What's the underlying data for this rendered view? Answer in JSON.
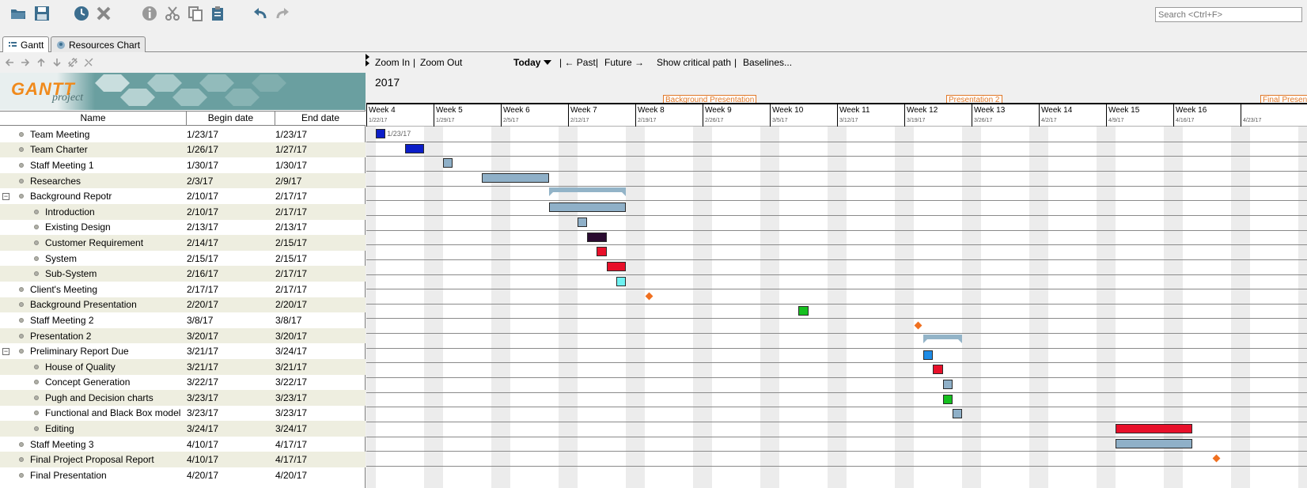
{
  "toolbar": {
    "search_placeholder": "Search <Ctrl+F>"
  },
  "tabs": [
    {
      "label": "Gantt",
      "active": true
    },
    {
      "label": "Resources Chart",
      "active": false
    }
  ],
  "logo": {
    "text": "GANTT",
    "sub": "project"
  },
  "table": {
    "headers": {
      "name": "Name",
      "begin": "Begin date",
      "end": "End date"
    },
    "rows": [
      {
        "name": "Team Meeting",
        "begin": "1/23/17",
        "end": "1/23/17",
        "level": 0,
        "group": false
      },
      {
        "name": "Team Charter",
        "begin": "1/26/17",
        "end": "1/27/17",
        "level": 0,
        "group": false
      },
      {
        "name": "Staff Meeting 1",
        "begin": "1/30/17",
        "end": "1/30/17",
        "level": 0,
        "group": false
      },
      {
        "name": "Researches",
        "begin": "2/3/17",
        "end": "2/9/17",
        "level": 0,
        "group": false
      },
      {
        "name": "Background Repotr",
        "begin": "2/10/17",
        "end": "2/17/17",
        "level": 0,
        "group": true
      },
      {
        "name": "Introduction",
        "begin": "2/10/17",
        "end": "2/17/17",
        "level": 1,
        "group": false
      },
      {
        "name": "Existing Design",
        "begin": "2/13/17",
        "end": "2/13/17",
        "level": 1,
        "group": false
      },
      {
        "name": "Customer Requirement",
        "begin": "2/14/17",
        "end": "2/15/17",
        "level": 1,
        "group": false
      },
      {
        "name": "System",
        "begin": "2/15/17",
        "end": "2/15/17",
        "level": 1,
        "group": false
      },
      {
        "name": "Sub-System",
        "begin": "2/16/17",
        "end": "2/17/17",
        "level": 1,
        "group": false
      },
      {
        "name": "Client's Meeting",
        "begin": "2/17/17",
        "end": "2/17/17",
        "level": 0,
        "group": false
      },
      {
        "name": "Background Presentation",
        "begin": "2/20/17",
        "end": "2/20/17",
        "level": 0,
        "group": false
      },
      {
        "name": "Staff Meeting 2",
        "begin": "3/8/17",
        "end": "3/8/17",
        "level": 0,
        "group": false
      },
      {
        "name": "Presentation 2",
        "begin": "3/20/17",
        "end": "3/20/17",
        "level": 0,
        "group": false
      },
      {
        "name": "Preliminary Report Due",
        "begin": "3/21/17",
        "end": "3/24/17",
        "level": 0,
        "group": true
      },
      {
        "name": "House of Quality",
        "begin": "3/21/17",
        "end": "3/21/17",
        "level": 1,
        "group": false
      },
      {
        "name": "Concept Generation",
        "begin": "3/22/17",
        "end": "3/22/17",
        "level": 1,
        "group": false
      },
      {
        "name": "Pugh and Decision charts",
        "begin": "3/23/17",
        "end": "3/23/17",
        "level": 1,
        "group": false
      },
      {
        "name": "Functional and Black Box model",
        "begin": "3/23/17",
        "end": "3/23/17",
        "level": 1,
        "group": false
      },
      {
        "name": "Editing",
        "begin": "3/24/17",
        "end": "3/24/17",
        "level": 1,
        "group": false
      },
      {
        "name": "Staff Meeting 3",
        "begin": "4/10/17",
        "end": "4/17/17",
        "level": 0,
        "group": false
      },
      {
        "name": "Final Project Proposal Report",
        "begin": "4/10/17",
        "end": "4/17/17",
        "level": 0,
        "group": false
      },
      {
        "name": "Final Presentation",
        "begin": "4/20/17",
        "end": "4/20/17",
        "level": 0,
        "group": false
      }
    ]
  },
  "chart_tools": {
    "zoom_in": "Zoom In",
    "sep1": "|",
    "zoom_out": "Zoom Out",
    "today": "Today",
    "past": "| ← Past",
    "sep2": "|",
    "future": "Future →",
    "critical": "Show critical path",
    "sep3": "|",
    "baselines": "Baselines..."
  },
  "chart": {
    "year": "2017",
    "milestone_labels": [
      "Background Presentation",
      "Presentation 2",
      "Final Presen"
    ],
    "weeks": [
      {
        "label": "Week 4",
        "date": "1/22/17"
      },
      {
        "label": "Week 5",
        "date": "1/29/17"
      },
      {
        "label": "Week 6",
        "date": "2/5/17"
      },
      {
        "label": "Week 7",
        "date": "2/12/17"
      },
      {
        "label": "Week 8",
        "date": "2/19/17"
      },
      {
        "label": "Week 9",
        "date": "2/26/17"
      },
      {
        "label": "Week 10",
        "date": "3/5/17"
      },
      {
        "label": "Week 11",
        "date": "3/12/17"
      },
      {
        "label": "Week 12",
        "date": "3/19/17"
      },
      {
        "label": "Week 13",
        "date": "3/26/17"
      },
      {
        "label": "Week 14",
        "date": "4/2/17"
      },
      {
        "label": "Week 15",
        "date": "4/9/17"
      },
      {
        "label": "Week 16",
        "date": "4/16/17"
      },
      {
        "label": "",
        "date": "4/23/17"
      }
    ],
    "first_bar_label": "1/23/17",
    "bar_colors": [
      "#0c1ec8",
      "#0c1ec8",
      "#8fb0c8",
      "#8fb0c8",
      "",
      "#8fb0c8",
      "#8fb0c8",
      "#2a0a30",
      "#e8102a",
      "#e8102a",
      "#6ef2f2",
      "",
      "#16c020",
      "",
      "",
      "#1e8ce6",
      "#e8102a",
      "#8fb0c8",
      "#16c020",
      "#8fb0c8",
      "#e8102a",
      "#8fb0c8",
      ""
    ]
  }
}
